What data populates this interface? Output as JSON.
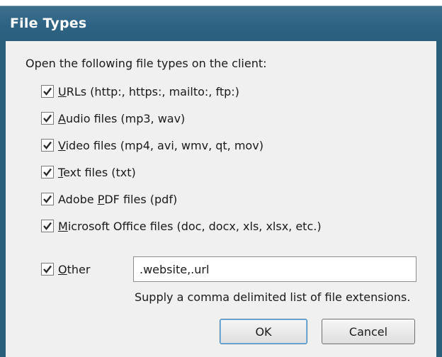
{
  "dialog": {
    "title": "File Types",
    "intro": "Open the following file types on the client:",
    "options": [
      {
        "key": "U",
        "rest": "RLs (http:, https:, mailto:, ftp:)",
        "checked": true
      },
      {
        "key": "A",
        "rest": "udio files (mp3, wav)",
        "checked": true
      },
      {
        "key": "V",
        "rest": "ideo files (mp4, avi, wmv, qt, mov)",
        "checked": true
      },
      {
        "key": "T",
        "rest": "ext files (txt)",
        "checked": true
      },
      {
        "pre": "Adobe ",
        "key": "P",
        "rest": "DF files (pdf)",
        "checked": true
      },
      {
        "key": "M",
        "rest": "icrosoft Office files (doc, docx, xls, xlsx, etc.)",
        "checked": true
      },
      {
        "key": "O",
        "rest": "ther",
        "checked": true
      }
    ],
    "other_value": ".website,.url",
    "hint": "Supply a comma delimited list of file extensions.",
    "ok_label": "OK",
    "cancel_label": "Cancel"
  },
  "colors": {
    "titlebar": "#2a5f7c",
    "title_text": "#ffffff",
    "dialog_bg": "#f0f0f0",
    "ok_border": "#3c7fb1"
  }
}
